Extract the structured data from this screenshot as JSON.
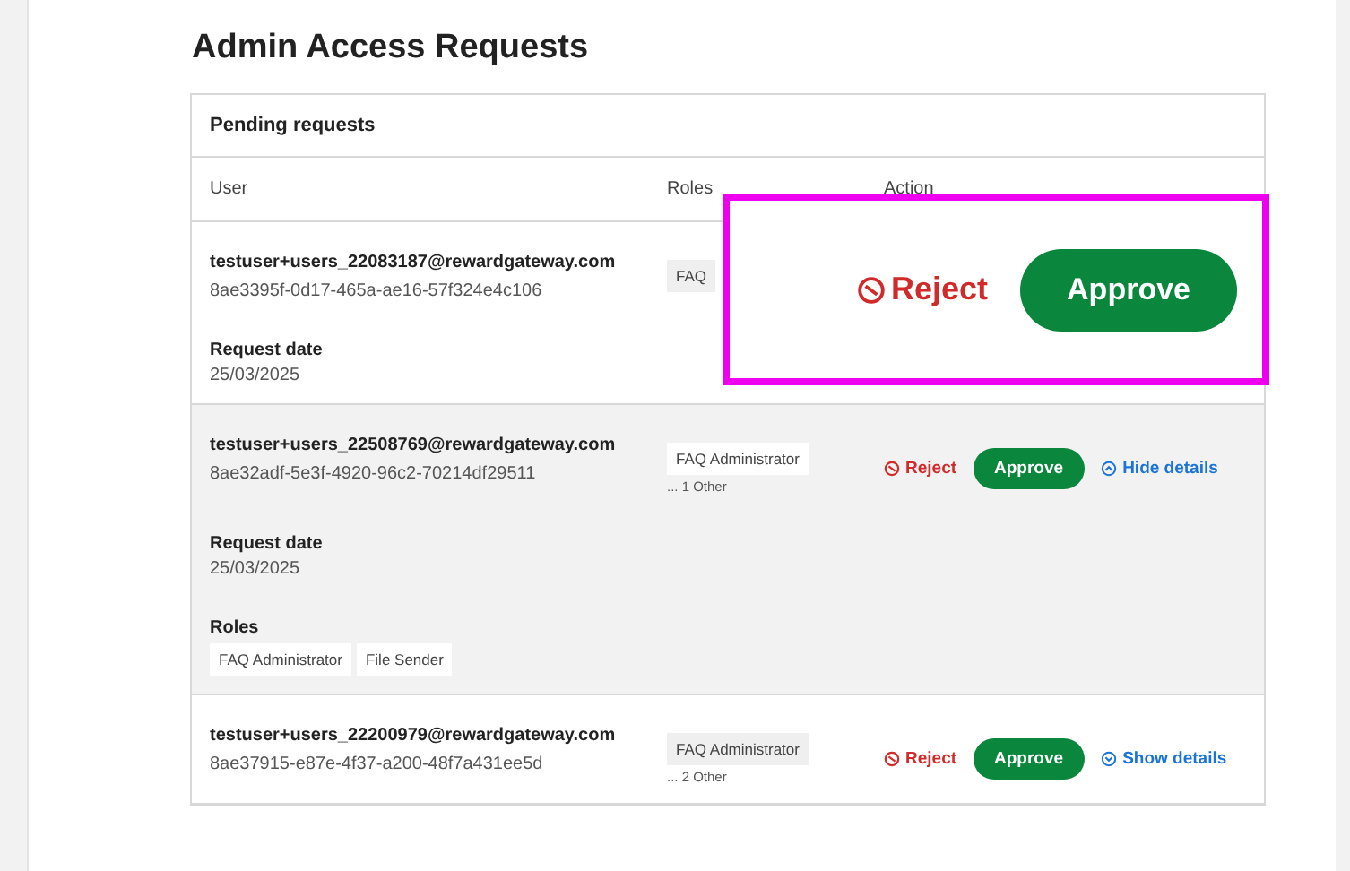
{
  "page": {
    "title": "Admin Access Requests"
  },
  "card": {
    "title": "Pending requests",
    "columns": [
      "User",
      "Roles",
      "Action"
    ]
  },
  "rows": [
    {
      "email": "testuser+users_22083187@rewardgateway.com",
      "id": "8ae3395f-0d17-465a-ae16-57f324e4c106",
      "role": "FAQ",
      "expanded": false,
      "date_label": "Request date",
      "date": "25/03/2025"
    },
    {
      "email": "testuser+users_22508769@rewardgateway.com",
      "id": "8ae32adf-5e3f-4920-96c2-70214df29511",
      "role": "FAQ Administrator",
      "others": "... 1 Other",
      "reject": "Reject",
      "approve": "Approve",
      "toggle": "Hide details",
      "expanded": true,
      "date_label": "Request date",
      "date": "25/03/2025",
      "roles_label": "Roles",
      "detail_roles": [
        "FAQ Administrator",
        "File Sender"
      ]
    },
    {
      "email": "testuser+users_22200979@rewardgateway.com",
      "id": "8ae37915-e87e-4f37-a200-48f7a431ee5d",
      "role": "FAQ Administrator",
      "others": "... 2 Other",
      "reject": "Reject",
      "approve": "Approve",
      "toggle": "Show details",
      "expanded": false
    }
  ],
  "callout": {
    "reject": "Reject",
    "approve": "Approve"
  }
}
